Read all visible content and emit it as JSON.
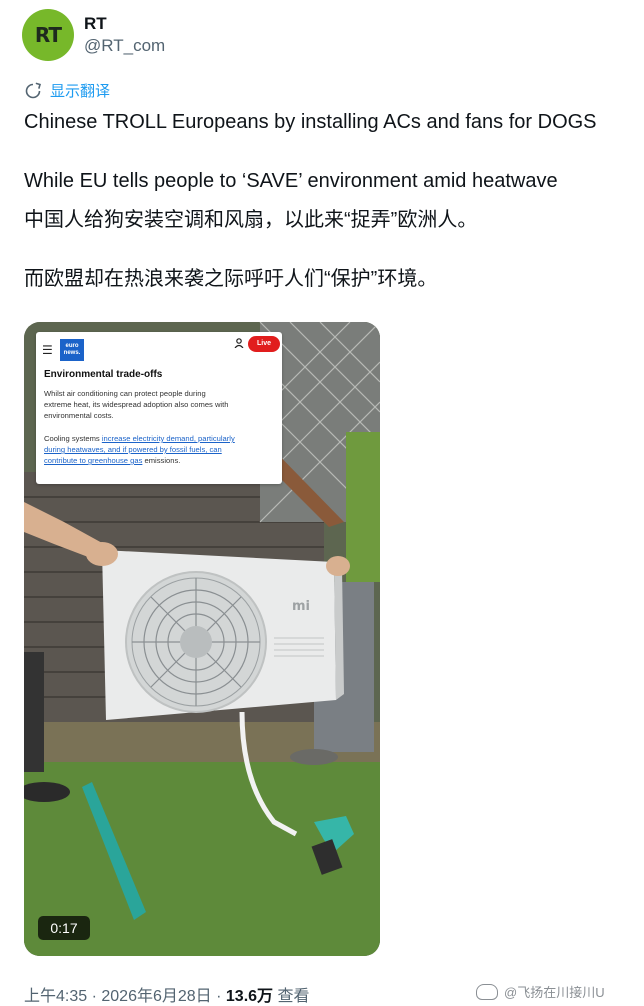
{
  "account": {
    "avatar_text": "RT",
    "display_name": "RT",
    "handle": "@RT_com",
    "avatar_color": "#77b82a"
  },
  "translate": {
    "icon": "translate-icon",
    "label": "显示翻译"
  },
  "post": {
    "line1": "Chinese TROLL Europeans by installing ACs and fans for DOGS",
    "line2": "While EU tells people to ‘SAVE’ environment amid heatwave",
    "line3": "中国人给狗安装空调和风扇，以此来“捉弄”欧洲人。",
    "line4": "而欧盟却在热浪来袭之际呼吁人们“保护”环境。"
  },
  "media": {
    "duration": "0:17",
    "ac_brand": "mi",
    "article": {
      "logo_line1": "euro",
      "logo_line2": "news.",
      "live_label": "Live",
      "title": "Environmental trade-offs",
      "p1": "Whilst air conditioning can protect people during extreme heat, its widespread adoption also comes with environmental costs.",
      "p2_start": "Cooling systems ",
      "p2_link": "increase electricity demand, particularly during heatwaves, and if powered by fossil fuels, can contribute to greenhouse gas",
      "p2_end": " emissions."
    }
  },
  "meta": {
    "time": "上午4:35",
    "sep1": " · ",
    "date": "2026年6月28日",
    "sep2": " · ",
    "views_count": "13.6万",
    "views_label": " 查看"
  },
  "watermark": {
    "text": "@飞扬在川接川U"
  },
  "colors": {
    "accent": "#1d9bf0",
    "muted": "#536471",
    "live_red": "#e11d1d",
    "euronews_blue": "#1b63c9"
  }
}
